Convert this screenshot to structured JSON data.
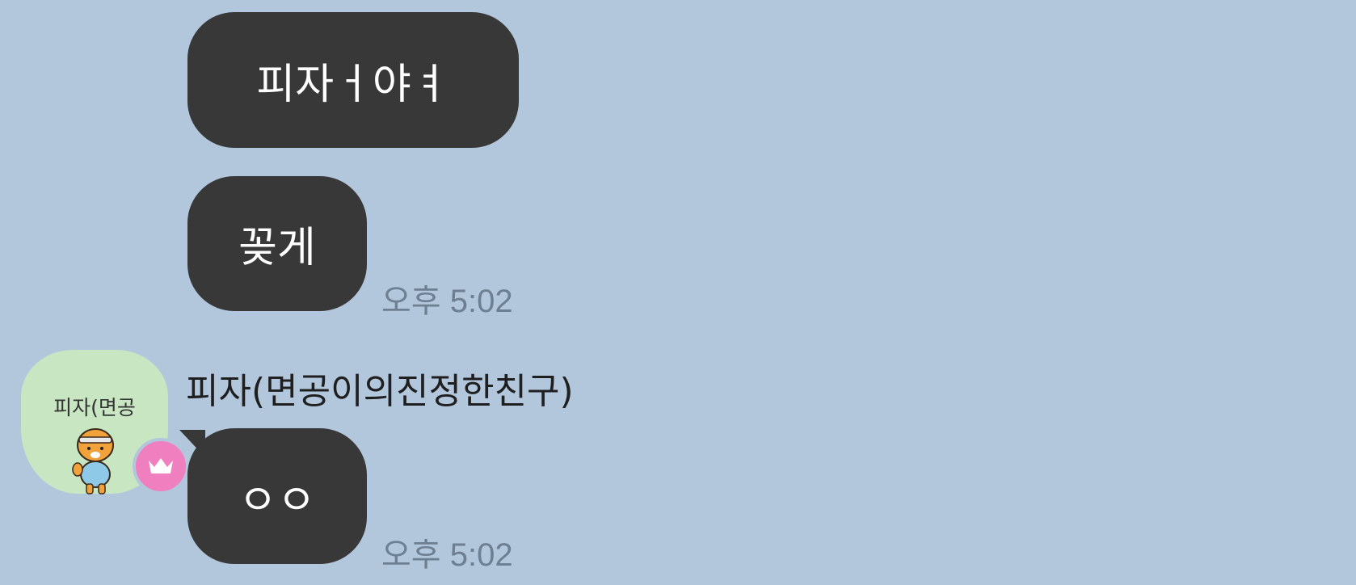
{
  "chat": {
    "messages": [
      {
        "text": "피자ㅓ야ㅕ"
      },
      {
        "text": "꽂게",
        "time": "오후 5:02"
      },
      {
        "text": "ㅇㅇ",
        "time": "오후 5:02"
      }
    ],
    "sender": {
      "name": "피자(면공이의진정한친구)",
      "avatar_text": "피자(면공"
    }
  },
  "colors": {
    "background": "#b2c7dc",
    "bubble": "#383838",
    "avatar_bg": "#c8e6c2",
    "crown_badge": "#f07fbf"
  },
  "icons": {
    "crown": "crown-icon",
    "character": "ryan-character-icon"
  }
}
